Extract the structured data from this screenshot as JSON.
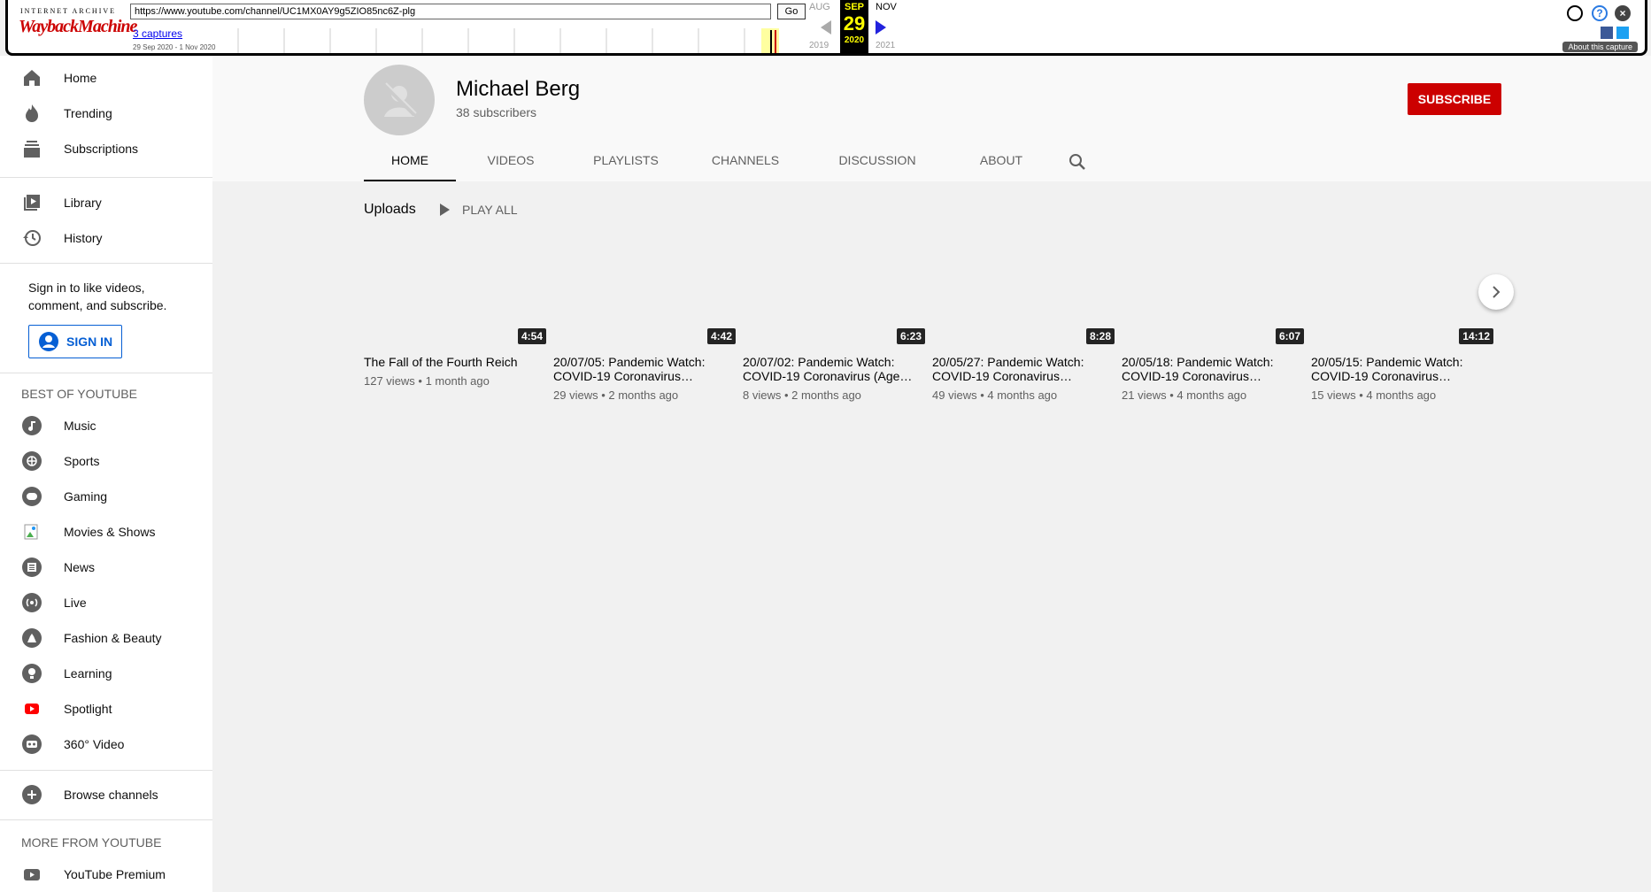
{
  "wayback": {
    "brand_top": "INTERNET ARCHIVE",
    "brand_logo": "WaybackMachine",
    "url": "https://www.youtube.com/channel/UC1MX0AY9g5ZIO85nc6Z-plg",
    "go_label": "Go",
    "captures": "3 captures",
    "range": "29 Sep 2020 - 1 Nov 2020",
    "prev_month": "AUG",
    "cur_month": "SEP",
    "next_month": "NOV",
    "cur_day": "29",
    "prev_year": "2019",
    "cur_year": "2020",
    "next_year": "2021",
    "about": "About this capture"
  },
  "sidebar": {
    "main": [
      {
        "label": "Home",
        "icon": "home-icon"
      },
      {
        "label": "Trending",
        "icon": "trending-icon"
      },
      {
        "label": "Subscriptions",
        "icon": "subscriptions-icon"
      }
    ],
    "library": [
      {
        "label": "Library",
        "icon": "library-icon"
      },
      {
        "label": "History",
        "icon": "history-icon"
      }
    ],
    "signin_text": "Sign in to like videos, comment, and subscribe.",
    "signin_button": "SIGN IN",
    "best_heading": "BEST OF YOUTUBE",
    "best": [
      {
        "label": "Music",
        "icon": "music-icon"
      },
      {
        "label": "Sports",
        "icon": "sports-icon"
      },
      {
        "label": "Gaming",
        "icon": "gaming-icon"
      },
      {
        "label": "Movies & Shows",
        "icon": "movies-icon"
      },
      {
        "label": "News",
        "icon": "news-icon"
      },
      {
        "label": "Live",
        "icon": "live-icon"
      },
      {
        "label": "Fashion & Beauty",
        "icon": "fashion-icon"
      },
      {
        "label": "Learning",
        "icon": "learning-icon"
      },
      {
        "label": "Spotlight",
        "icon": "spotlight-icon"
      },
      {
        "label": "360° Video",
        "icon": "vr-icon"
      }
    ],
    "browse_channels": "Browse channels",
    "more_heading": "MORE FROM YOUTUBE",
    "premium": "YouTube Premium"
  },
  "channel": {
    "name": "Michael Berg",
    "subscribers": "38 subscribers",
    "subscribe_label": "SUBSCRIBE",
    "tabs": [
      "HOME",
      "VIDEOS",
      "PLAYLISTS",
      "CHANNELS",
      "DISCUSSION",
      "ABOUT"
    ]
  },
  "uploads": {
    "title": "Uploads",
    "play_all": "PLAY ALL",
    "videos": [
      {
        "duration": "4:54",
        "title": "The Fall of the Fourth Reich",
        "views": "127 views",
        "age": "1 month ago"
      },
      {
        "duration": "4:42",
        "title": "20/07/05: Pandemic Watch: COVID-19 Coronavirus…",
        "views": "29 views",
        "age": "2 months ago"
      },
      {
        "duration": "6:23",
        "title": "20/07/02: Pandemic Watch: COVID-19 Coronavirus (Age…",
        "views": "8 views",
        "age": "2 months ago"
      },
      {
        "duration": "8:28",
        "title": "20/05/27: Pandemic Watch: COVID-19 Coronavirus…",
        "views": "49 views",
        "age": "4 months ago"
      },
      {
        "duration": "6:07",
        "title": "20/05/18: Pandemic Watch: COVID-19 Coronavirus…",
        "views": "21 views",
        "age": "4 months ago"
      },
      {
        "duration": "14:12",
        "title": "20/05/15: Pandemic Watch: COVID-19 Coronavirus…",
        "views": "15 views",
        "age": "4 months ago"
      }
    ]
  }
}
